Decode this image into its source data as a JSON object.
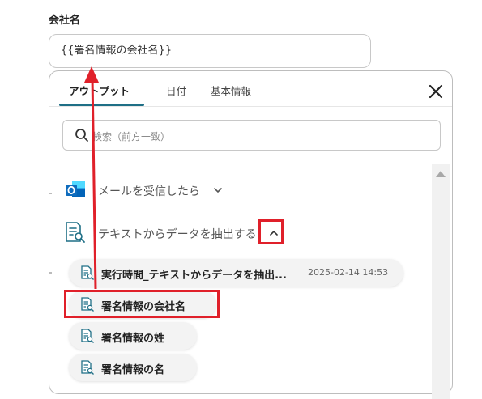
{
  "field": {
    "label": "会社名",
    "value": "{{署名情報の会社名}}"
  },
  "panel": {
    "tabs": [
      {
        "label": "アウトプット",
        "active": true
      },
      {
        "label": "日付",
        "active": false
      },
      {
        "label": "基本情報",
        "active": false
      }
    ],
    "search_placeholder": "検索（前方一致）",
    "sources": [
      {
        "label": "メールを受信したら",
        "icon": "outlook-icon",
        "expanded": false
      },
      {
        "label": "テキストからデータを抽出する",
        "icon": "ai-extract-document-icon",
        "expanded": true
      }
    ],
    "items": [
      {
        "label": "実行時間_テキストからデータを抽出...",
        "meta": "2025-02-14 14:53"
      },
      {
        "label": "署名情報の会社名",
        "meta": ""
      },
      {
        "label": "署名情報の姓",
        "meta": ""
      },
      {
        "label": "署名情報の名",
        "meta": ""
      }
    ]
  },
  "colors": {
    "accent": "#1f6f86",
    "annotation_red": "#e0202a",
    "outlook_blue": "#0f6cbd"
  }
}
